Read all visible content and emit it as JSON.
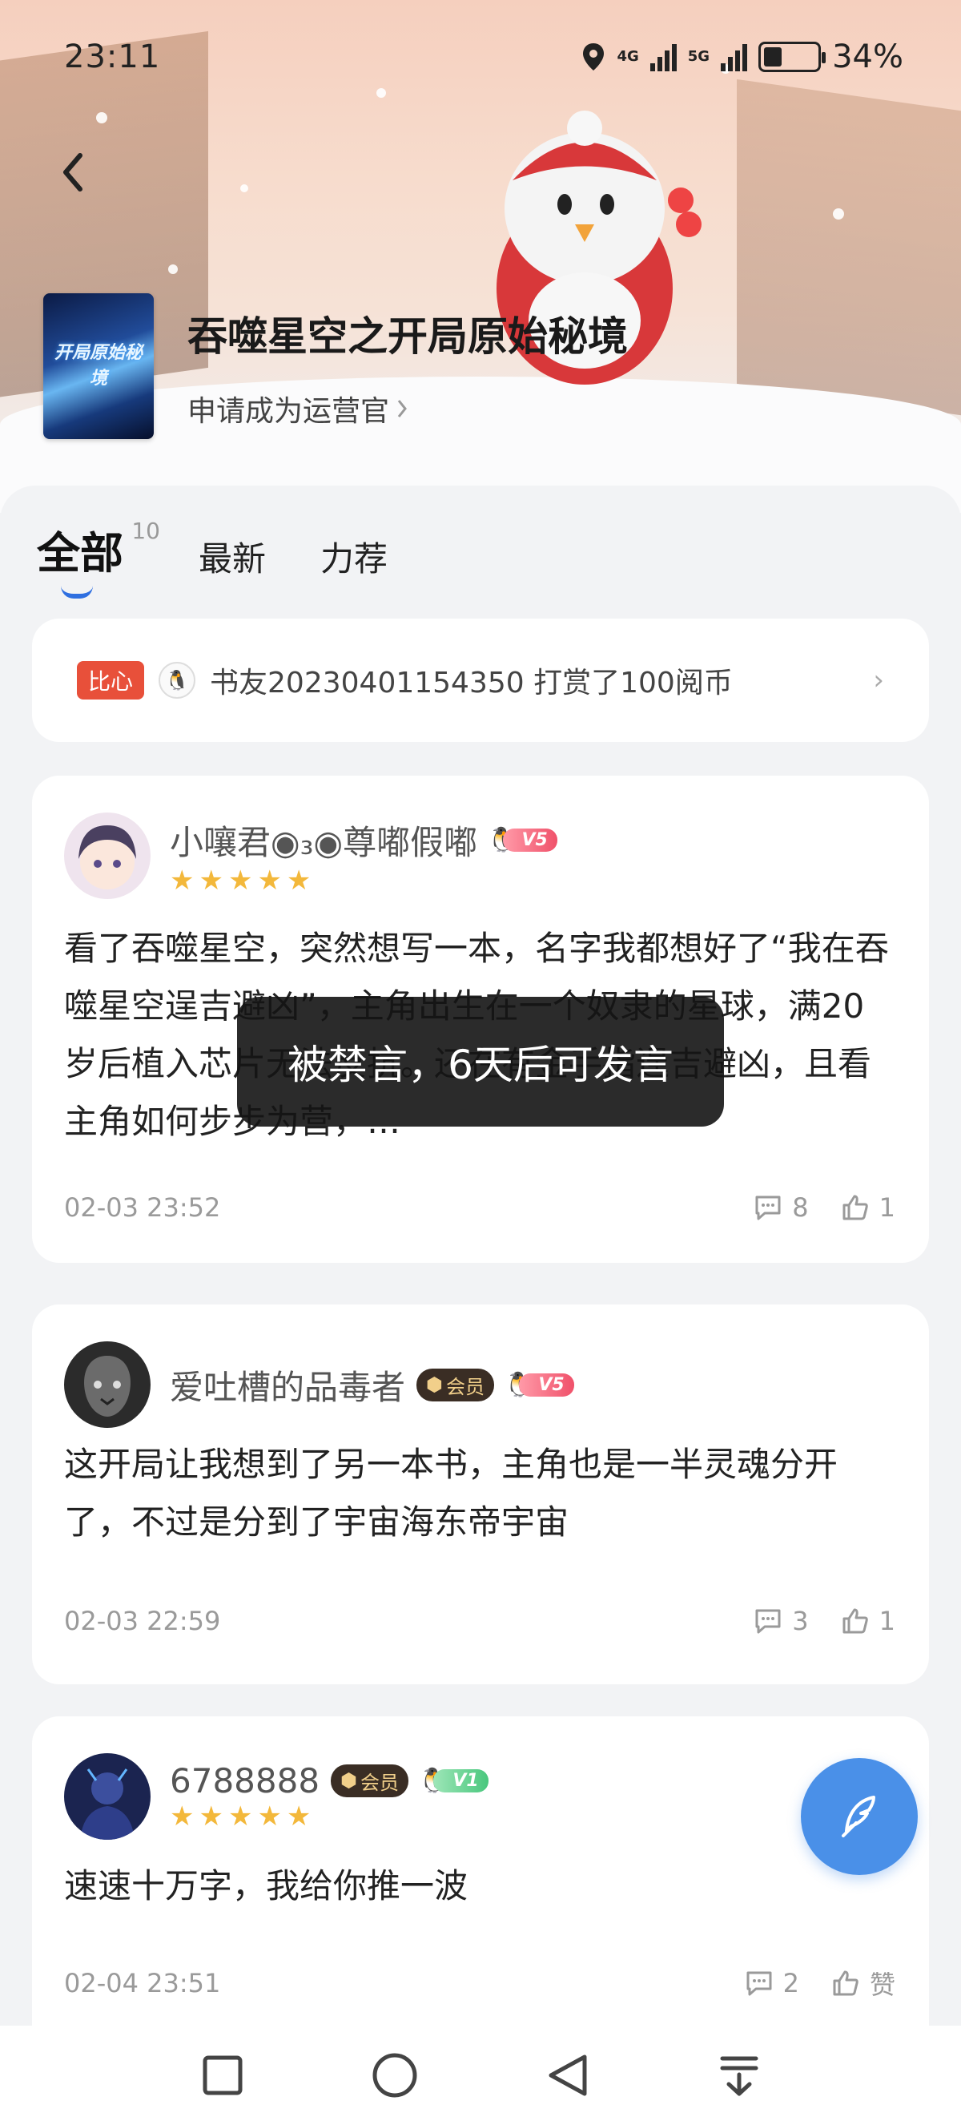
{
  "status_bar": {
    "time": "23:11",
    "network_1": "4G",
    "network_2": "5G",
    "battery": "34%"
  },
  "book": {
    "cover_title": "开局原始秘境",
    "title": "吞噬星空之开局原始秘境",
    "apply_link": "申请成为运营官"
  },
  "tabs": [
    {
      "label": "全部",
      "count": "10"
    },
    {
      "label": "最新"
    },
    {
      "label": "力荐"
    }
  ],
  "gift": {
    "badge": "比心",
    "text": "书友20230401154350 打赏了100阅币"
  },
  "reviews": [
    {
      "user": "小嚷君◉₃◉尊嘟假嘟",
      "level": "V5",
      "stars": "★★★★★",
      "text": "看了吞噬星空，突然想写一本，名字我都想好了“我在吞噬星空逞吉避凶”，主角出生在一个奴隶的星球，满20岁后植入芯片无法反抗。还在有金手指逞吉避凶，且看主角如何步步为营，…",
      "date": "02-03 23:52",
      "comments": "8",
      "likes": "1"
    },
    {
      "user": "爱吐槽的品毒者",
      "member": "会员",
      "level": "V5",
      "text": "这开局让我想到了另一本书，主角也是一半灵魂分开了，不过是分到了宇宙海东帝宇宙",
      "date": "02-03 22:59",
      "comments": "3",
      "likes": "1"
    },
    {
      "user": "6788888",
      "member": "会员",
      "level": "V1",
      "stars": "★★★★★",
      "text": "速速十万字，我给你推一波",
      "date": "02-04 23:51",
      "comments": "2",
      "likes": "赞"
    }
  ],
  "toast": "被禁言，6天后可发言",
  "colors": {
    "accent": "#2f6fe0",
    "fab": "#4a90e8",
    "star": "#f3b83b",
    "gift_badge": "#e8503a"
  }
}
